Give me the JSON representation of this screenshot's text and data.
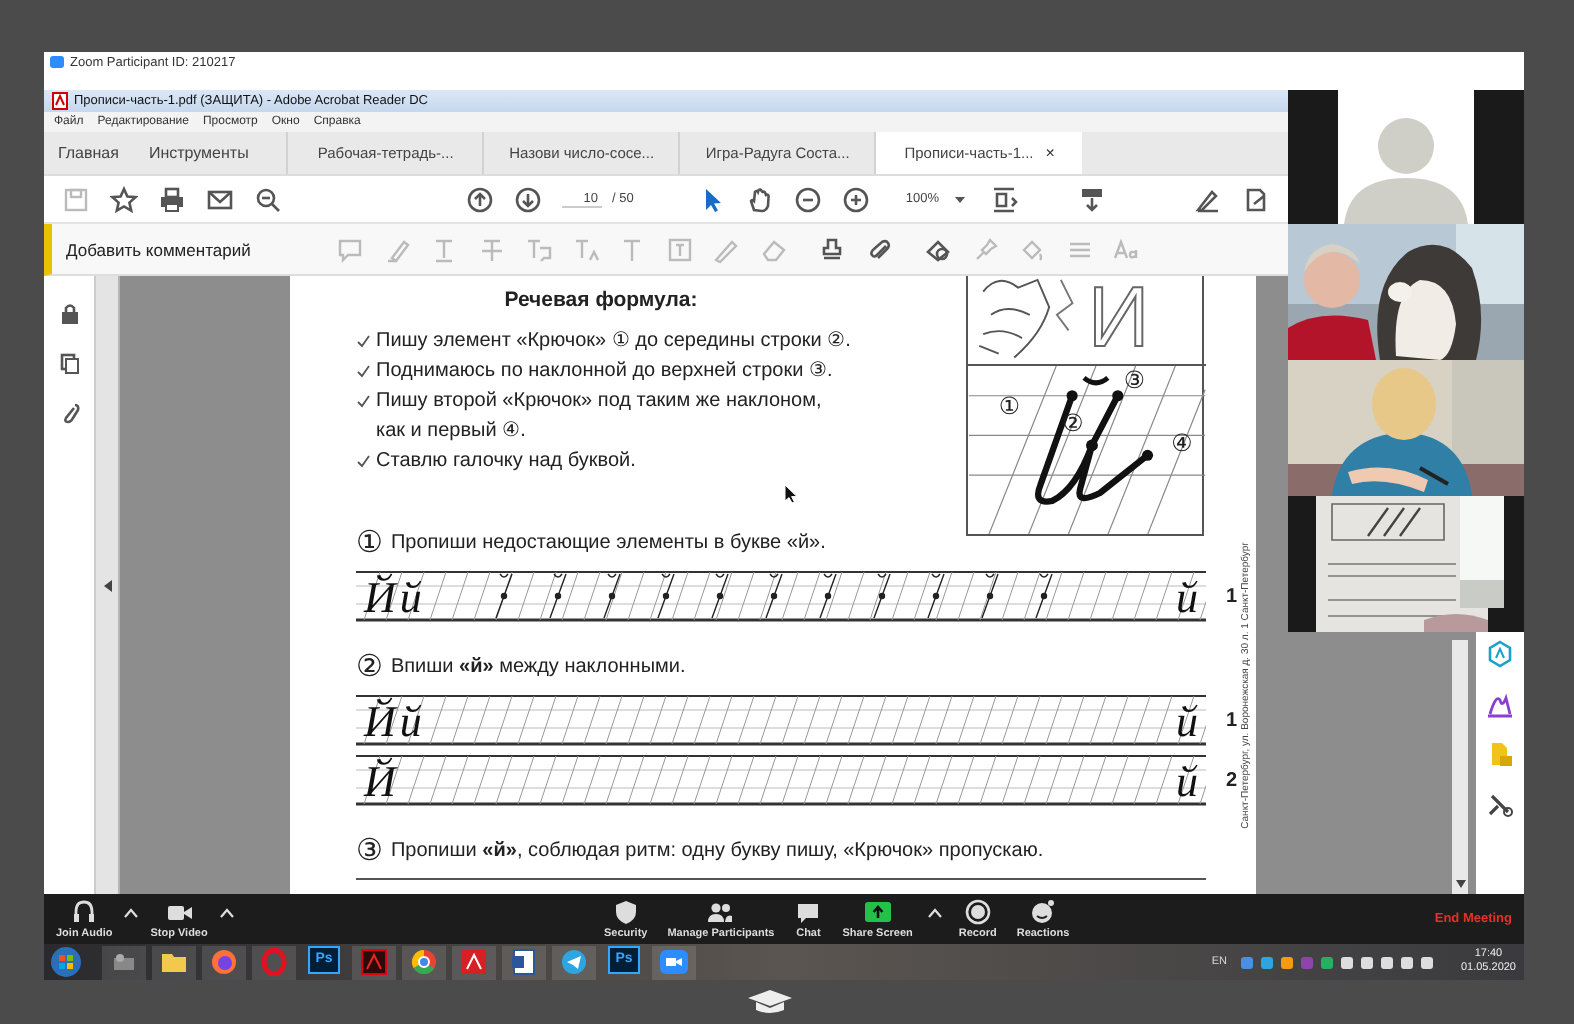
{
  "zoom_window": {
    "title": "Zoom Participant ID: 210217"
  },
  "acrobat": {
    "title": "Прописи-часть-1.pdf (ЗАЩИТА) - Adobe Acrobat Reader DC",
    "menu": [
      "Файл",
      "Редактирование",
      "Просмотр",
      "Окно",
      "Справка"
    ],
    "tabs": [
      {
        "label": "Главная",
        "kind": "home",
        "selected": false
      },
      {
        "label": "Инструменты",
        "kind": "home",
        "selected": false
      },
      {
        "label": "Рабочая-тетрадь-...",
        "kind": "document",
        "selected": false
      },
      {
        "label": "Назови число-сосе...",
        "kind": "document",
        "selected": false
      },
      {
        "label": "Игра-Радуга Соста...",
        "kind": "document",
        "selected": false
      },
      {
        "label": "Прописи-часть-1...",
        "kind": "document",
        "selected": true,
        "close": "×"
      }
    ],
    "page_number": "10",
    "page_count": "/ 50",
    "zoom": "100%",
    "comment_bar": "Добавить комментарий"
  },
  "document": {
    "heading": "Речевая формула:",
    "steps": [
      "Пишу элемент «Крючок» ① до  середины строки ②.",
      "Поднимаюсь по наклонной до верхней строки ③.",
      "Пишу второй «Крючок» под таким же наклоном,\nкак и первый ④.",
      "Ставлю галочку над буквой."
    ],
    "illustration_letter": "И",
    "diagram_labels": [
      "①",
      "②",
      "③",
      "④"
    ],
    "exercises": [
      {
        "number": "①",
        "text": "Пропиши недостающие элементы в букве «й».",
        "lines": [
          {
            "number": "1",
            "kind": "elements",
            "left": [
              "Й",
              "й"
            ],
            "right": [
              "й"
            ]
          }
        ]
      },
      {
        "number": "②",
        "text": "Впиши **«й»** между наклонными.",
        "lines": [
          {
            "number": "1",
            "kind": "blank",
            "left": [
              "Й",
              "й"
            ],
            "right": [
              "й"
            ]
          },
          {
            "number": "2",
            "kind": "blank",
            "left": [
              "Й"
            ],
            "right": [
              "й"
            ]
          }
        ]
      },
      {
        "number": "③",
        "text": "Пропиши **«й»**, соблюдая ритм: одну букву пишу, «Крючок» пропускаю."
      }
    ],
    "side_note": "Санкт-Петербург, ул. Воронежская д. 30 л. 1 Санкт-Петербург"
  },
  "participants": [
    {
      "kind": "avatar"
    },
    {
      "kind": "picture"
    },
    {
      "kind": "picture"
    },
    {
      "kind": "picture"
    }
  ],
  "meeting_controls": [
    {
      "label": "Join Audio",
      "kind": "audio",
      "caret": true
    },
    {
      "label": "Stop Video",
      "kind": "video",
      "caret": true
    },
    {
      "label": "Security",
      "kind": "security",
      "caret": false
    },
    {
      "label": "Manage Participants",
      "kind": "participants",
      "caret": false
    },
    {
      "label": "Chat",
      "kind": "chat",
      "caret": false
    },
    {
      "label": "Share Screen",
      "kind": "share",
      "caret": true
    },
    {
      "label": "Record",
      "kind": "record",
      "caret": false
    },
    {
      "label": "Reactions",
      "kind": "reactions",
      "caret": false
    }
  ],
  "end_meeting": "End Meeting",
  "taskbar": {
    "apps": [
      {
        "kind": "media"
      },
      {
        "kind": "folder"
      },
      {
        "kind": "fox"
      },
      {
        "kind": "ring"
      },
      {
        "kind": "ps",
        "label": "Ps"
      },
      {
        "kind": "pdf-dark"
      },
      {
        "kind": "chrome"
      },
      {
        "kind": "pdf"
      },
      {
        "kind": "doc"
      },
      {
        "kind": "plane"
      },
      {
        "kind": "ps",
        "label": "Ps"
      },
      {
        "kind": "camera"
      }
    ],
    "language": "EN",
    "time": "17:40",
    "date": "01.05.2020"
  }
}
